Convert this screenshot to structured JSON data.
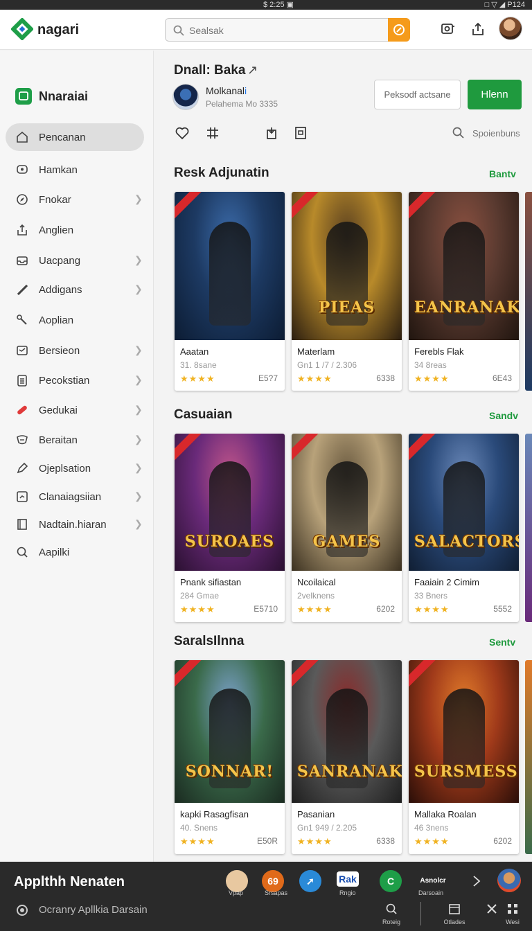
{
  "status_bar": {
    "center": "$ 2:25 ▣",
    "right": "□ ▽ ◢ P124"
  },
  "header": {
    "brand": "nagari",
    "search": {
      "placeholder": "Sealsak"
    }
  },
  "sidebar": {
    "title": "Nnaraiai",
    "items": [
      {
        "label": "Pencanan",
        "icon": "home-icon",
        "active": true,
        "chevron": false
      },
      {
        "label": "Hamkan",
        "icon": "chat-icon",
        "chevron": false
      },
      {
        "label": "Fnokar",
        "icon": "compass-icon",
        "chevron": true
      },
      {
        "label": "Anglien",
        "icon": "upload-icon",
        "chevron": false
      },
      {
        "label": "Uacpang",
        "icon": "inbox-icon",
        "chevron": true
      },
      {
        "label": "Addigans",
        "icon": "brush-icon",
        "chevron": true
      },
      {
        "label": "Aoplian",
        "icon": "tools-icon",
        "chevron": false
      },
      {
        "label": "Bersieon",
        "icon": "card-icon",
        "chevron": true
      },
      {
        "label": "Pecokstian",
        "icon": "list-icon",
        "chevron": true
      },
      {
        "label": "Gedukai",
        "icon": "bandage-icon",
        "chevron": true
      },
      {
        "label": "Beraitan",
        "icon": "theater-icon",
        "chevron": true
      },
      {
        "label": "Ojeplsation",
        "icon": "pen-icon",
        "chevron": true
      },
      {
        "label": "Clanaiagsiian",
        "icon": "chart-icon",
        "chevron": true
      },
      {
        "label": "Nadtain.hiaran",
        "icon": "book-icon",
        "chevron": true
      },
      {
        "label": "Aapilki",
        "icon": "search-icon",
        "chevron": false
      }
    ]
  },
  "app": {
    "title": "Dnall: Baka",
    "title_arrow": "↗",
    "developer": {
      "name": "Molkanal",
      "verified_mark": "i",
      "meta": "Pelahema Mo 3335"
    },
    "secondary_button": "Peksodf actsane",
    "install_button": "Hlenn",
    "search_label": "Spoienbuns"
  },
  "sections": [
    {
      "title": "Resk Adjunatin",
      "link": "Bantv",
      "cards": [
        {
          "art_text": "",
          "name": "Aaatan",
          "sub": "31. 8sane",
          "stars": "★★★★",
          "price": "E5?7",
          "palette": [
            "#1d3a63",
            "#3b6aa8",
            "#0c1c33"
          ]
        },
        {
          "art_text": "PIEAS",
          "name": "Materlam",
          "sub": "Gn1 1 /7 / 2.306",
          "stars": "★★★★",
          "price": "6338",
          "palette": [
            "#b88a2a",
            "#5a4020",
            "#2a1d10"
          ]
        },
        {
          "art_text": "EANRANAK",
          "name": "Ferebls Flak",
          "sub": "34 8reas",
          "stars": "★★★★",
          "price": "6E43",
          "palette": [
            "#5a3a30",
            "#8a5040",
            "#20150f"
          ]
        }
      ]
    },
    {
      "title": "Casuaian",
      "link": "Sandv",
      "cards": [
        {
          "art_text": "SUROAES",
          "name": "Pnank sifiastan",
          "sub": "284 Gmae",
          "stars": "★★★★",
          "price": "E5710",
          "palette": [
            "#6a2a7a",
            "#c0558a",
            "#2a1030"
          ]
        },
        {
          "art_text": "GAMES",
          "name": "Ncoilaical",
          "sub": "2velknens",
          "stars": "★★★★",
          "price": "6202",
          "palette": [
            "#b8a27a",
            "#6a5a40",
            "#3a3020"
          ]
        },
        {
          "art_text": "SALACTORS",
          "name": "Faaiain 2 Cimim",
          "sub": "33 Bners",
          "stars": "★★★★",
          "price": "5552",
          "palette": [
            "#2a4a7a",
            "#6a88b8",
            "#101e33"
          ]
        }
      ]
    },
    {
      "title": "SaralsIlnna",
      "link": "Sentv",
      "cards": [
        {
          "art_text": "SONNAR!",
          "name": "kapki Rasagfisan",
          "sub": "40. Snens",
          "stars": "★★★★",
          "price": "E50R",
          "palette": [
            "#3a6a4a",
            "#7aa0c8",
            "#1a2a20"
          ]
        },
        {
          "art_text": "SANRANAK",
          "name": "Pasanian",
          "sub": "Gn1 949 / 2.205",
          "stars": "★★★★",
          "price": "6338",
          "palette": [
            "#5a5a5a",
            "#8a2a2a",
            "#1e1e1e"
          ]
        },
        {
          "art_text": "SURSMESS",
          "name": "Mallaka Roalan",
          "sub": "46 3nens",
          "stars": "★★★★",
          "price": "6202",
          "palette": [
            "#a03a1a",
            "#e07a2a",
            "#2a0e08"
          ]
        }
      ]
    }
  ],
  "bottom_bar": {
    "title": "Applthh Nenaten",
    "subtitle": "Ocranry Apllkia Darsain",
    "apps": [
      {
        "label": "Vpap",
        "color": "#e8c8a0"
      },
      {
        "label": "Srsapas",
        "color": "#e06a1a",
        "glyph": "69"
      },
      {
        "label": "",
        "color": "#2a8ad8",
        "glyph": "➚"
      },
      {
        "label": "Rngio",
        "color": "#ffffff",
        "glyph": "Rak"
      },
      {
        "label": "",
        "color": "#1e9e48",
        "glyph": "C"
      },
      {
        "label": "Darsoain",
        "color": "#2a2a2a",
        "glyph": "Asnolcr"
      }
    ],
    "nav": [
      {
        "label": "Roteig",
        "icon": "search-icon"
      },
      {
        "label": "Otlades",
        "icon": "calendar-icon"
      },
      {
        "label": "",
        "icon": "close-icon"
      },
      {
        "label": "Wesi",
        "icon": "grid-icon"
      }
    ]
  }
}
